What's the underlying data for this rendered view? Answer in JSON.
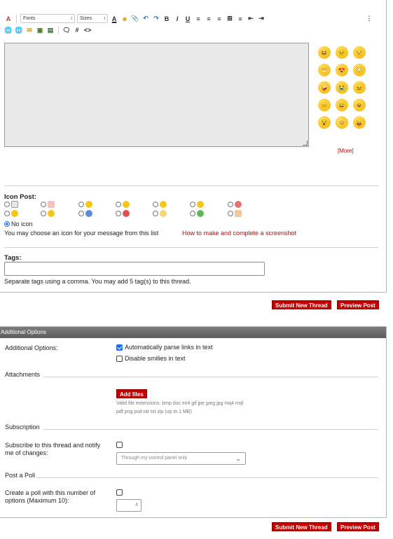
{
  "toolbar": {
    "font_select": "Fonts",
    "size_select": "Sizes"
  },
  "smilies": {
    "faces": [
      "😆",
      "😣",
      "😒",
      "😬",
      "😍",
      "😳",
      "🤪",
      "😭",
      "😖",
      "😑",
      "😀",
      "😺",
      "😵",
      "☺",
      "😛"
    ],
    "more_label": "[More]"
  },
  "icon_post": {
    "label": "Icon Post:",
    "no_icon_label": "No icon",
    "hint": "You may choose an icon for your message from this list",
    "help_link": "How to make and complete a screenshot"
  },
  "tags": {
    "label": "Tags:",
    "value": "",
    "hint": "Separate tags using a comma. You may add 5 tag(s) to this thread."
  },
  "buttons": {
    "submit": "Submit New Thread",
    "preview": "Preview Post"
  },
  "additional_options": {
    "header": "Additional Options",
    "label": "Additional Options:",
    "parse_links": "Automatically parse links in text",
    "parse_links_checked": true,
    "disable_smilies": "Disable smilies in text",
    "disable_smilies_checked": false
  },
  "attachments": {
    "title": "Attachments",
    "add_files": "Add files",
    "extensions_line1": "Valid file extensions: bmp doc ex4 gif jpe jpeg jpg mq4 mql",
    "extensions_line2": "pdf png psd rar txt zip (up to 1 MB)"
  },
  "subscription": {
    "title": "Subscription",
    "label_line1": "Subscribe to this thread and notify",
    "label_line2": "me of changes:",
    "select_value": "Through my control panel only"
  },
  "poll": {
    "title": "Post a Poll",
    "label_line1": "Create a poll with this number of",
    "label_line2": "options (Maximum 10):",
    "value": "4"
  }
}
